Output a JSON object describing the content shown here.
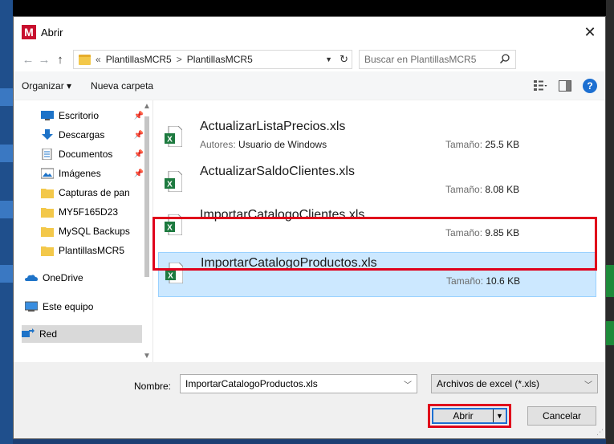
{
  "dialog": {
    "title": "Abrir",
    "app_icon_letter": "M"
  },
  "address": {
    "crumb_prefix": "«",
    "path": [
      "PlantillasMCR5",
      "PlantillasMCR5"
    ],
    "separator": ">",
    "search_placeholder": "Buscar en PlantillasMCR5"
  },
  "toolbar": {
    "organize_label": "Organizar ▾",
    "new_folder_label": "Nueva carpeta"
  },
  "sidebar": {
    "quick_access": [
      {
        "label": "Escritorio",
        "icon": "desktop-icon"
      },
      {
        "label": "Descargas",
        "icon": "download-icon"
      },
      {
        "label": "Documentos",
        "icon": "documents-icon"
      },
      {
        "label": "Imágenes",
        "icon": "pictures-icon"
      },
      {
        "label": "Capturas de pan",
        "icon": "folder-icon"
      },
      {
        "label": "MY5F165D23",
        "icon": "folder-icon"
      },
      {
        "label": "MySQL Backups",
        "icon": "folder-icon"
      },
      {
        "label": "PlantillasMCR5",
        "icon": "folder-icon"
      }
    ],
    "onedrive": "OneDrive",
    "this_pc": "Este equipo",
    "network": "Red"
  },
  "files": [
    {
      "name": "ActualizarListaPrecios.xls",
      "author_label": "Autores:",
      "author": "Usuario de Windows",
      "size_label": "Tamaño:",
      "size": "25.5 KB",
      "selected": false
    },
    {
      "name": "ActualizarSaldoClientes.xls",
      "size_label": "Tamaño:",
      "size": "8.08 KB",
      "selected": false
    },
    {
      "name": "ImportarCatalogoClientes.xls",
      "size_label": "Tamaño:",
      "size": "9.85 KB",
      "selected": false
    },
    {
      "name": "ImportarCatalogoProductos.xls",
      "size_label": "Tamaño:",
      "size": "10.6 KB",
      "selected": true
    }
  ],
  "footer": {
    "name_label": "Nombre:",
    "name_value": "ImportarCatalogoProductos.xls",
    "filter_value": "Archivos de excel (*.xls)",
    "open_label": "Abrir",
    "cancel_label": "Cancelar"
  },
  "colors": {
    "highlight": "#e0001b",
    "selection": "#cce8ff",
    "accent": "#1d6fd1"
  }
}
